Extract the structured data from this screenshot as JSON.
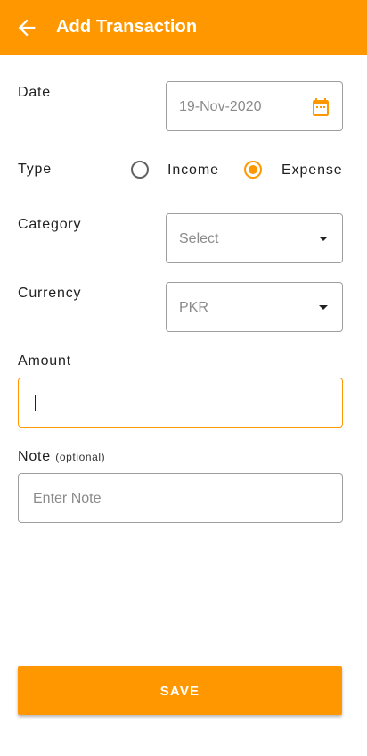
{
  "app_bar": {
    "title": "Add Transaction",
    "back_icon": "arrow-left-icon",
    "background": "#ff9800"
  },
  "form": {
    "date": {
      "label": "Date",
      "value": "19-Nov-2020",
      "icon": "calendar-icon"
    },
    "type": {
      "label": "Type",
      "options": [
        "Income",
        "Expense"
      ],
      "selected": "Expense"
    },
    "category": {
      "label": "Category",
      "placeholder": "Select"
    },
    "currency": {
      "label": "Currency",
      "value": "PKR"
    },
    "amount": {
      "label": "Amount",
      "value": ""
    },
    "note": {
      "label": "Note",
      "optional_hint": "(optional)",
      "placeholder": "Enter Note"
    }
  },
  "save_button": {
    "label": "SAVE"
  },
  "colors": {
    "accent": "#ff9800",
    "border": "#9e9e9e",
    "placeholder": "#8a8a8a"
  }
}
